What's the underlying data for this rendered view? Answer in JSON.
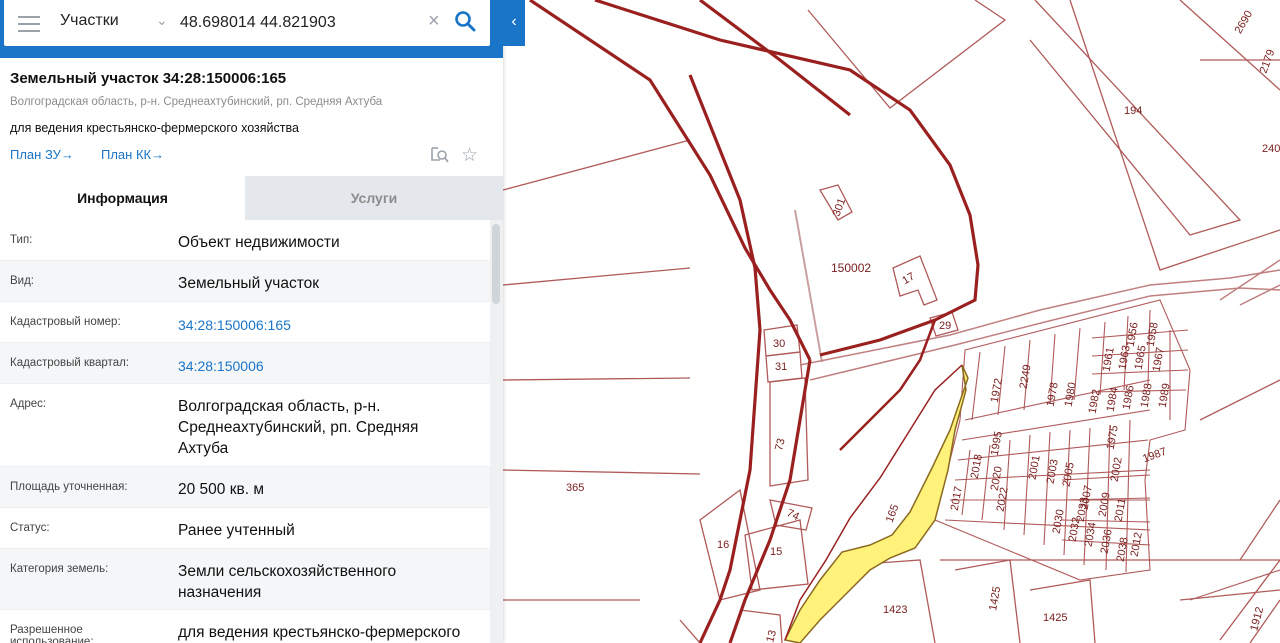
{
  "search": {
    "layer": "Участки",
    "query": "48.698014 44.821903"
  },
  "parcel": {
    "title": "Земельный участок 34:28:150006:165",
    "address_short": "Волгоградская область, р-н. Среднеахтубинский, рп. Средняя Ахтуба",
    "use_short": "для ведения крестьянско-фермерского хозяйства",
    "links": {
      "plan_zu": "План ЗУ→",
      "plan_kk": "План КК→"
    }
  },
  "tabs": {
    "info": "Информация",
    "services": "Услуги"
  },
  "properties": [
    {
      "label": "Тип:",
      "value": "Объект недвижимости"
    },
    {
      "label": "Вид:",
      "value": "Земельный участок"
    },
    {
      "label": "Кадастровый номер:",
      "value": "34:28:150006:165"
    },
    {
      "label": "Кадастровый квартал:",
      "value": "34:28:150006"
    },
    {
      "label": "Адрес:",
      "value": "Волгоградская область, р-н. Среднеахтубинский, рп. Средняя Ахтуба"
    },
    {
      "label": "Площадь уточненная:",
      "value": "20 500 кв. м"
    },
    {
      "label": "Статус:",
      "value": "Ранее учтенный"
    },
    {
      "label": "Категория земель:",
      "value": "Земли сельскохозяйственного назначения"
    },
    {
      "label": "Разрешенное использование:",
      "value": "для ведения крестьянско-фермерского хозяйства"
    }
  ],
  "map": {
    "labels": {
      "quarter": "150002",
      "p365": "365",
      "p194": "194",
      "p240": "240",
      "p301": "301",
      "p17": "17",
      "p29": "29",
      "p30": "30",
      "p31": "31",
      "p73": "73",
      "p74": "74",
      "p16": "16",
      "p15": "15",
      "p13": "13",
      "p165": "165",
      "p1423": "1423",
      "p1425a": "1425",
      "p1425b": "1425",
      "p2690": "2690",
      "p2179": "2179",
      "p1972": "1972",
      "p2249": "2249",
      "p1978": "1978",
      "p1980": "1980",
      "p1956": "1956",
      "p1958": "1958",
      "p1982": "1982",
      "p1984": "1984",
      "p1986": "1986",
      "p1988": "1988",
      "p1989": "1989",
      "p1961": "1961",
      "p1963": "1963",
      "p1965": "1965",
      "p1967": "1967",
      "p1975": "1975",
      "p1987": "1987",
      "p1995": "1995",
      "p2002": "2002",
      "p2017": "2017",
      "p2018": "2018",
      "p2020": "2020",
      "p2022": "2022",
      "p2001": "2001",
      "p2003": "2003",
      "p2005": "2005",
      "p2030": "2030",
      "p2032": "2032",
      "p2034": "2034",
      "p2036": "2036",
      "p2038": "2038",
      "p2007": "2007",
      "p2009": "2009",
      "p2011": "2011",
      "p2012": "2012",
      "p2033": "2033",
      "p1912": "1912"
    },
    "colors": {
      "boundary": "#9a2020",
      "thin": "#b05a5a",
      "highlight": "#fff27a"
    }
  },
  "colors": {
    "accent": "#1a75c9"
  }
}
